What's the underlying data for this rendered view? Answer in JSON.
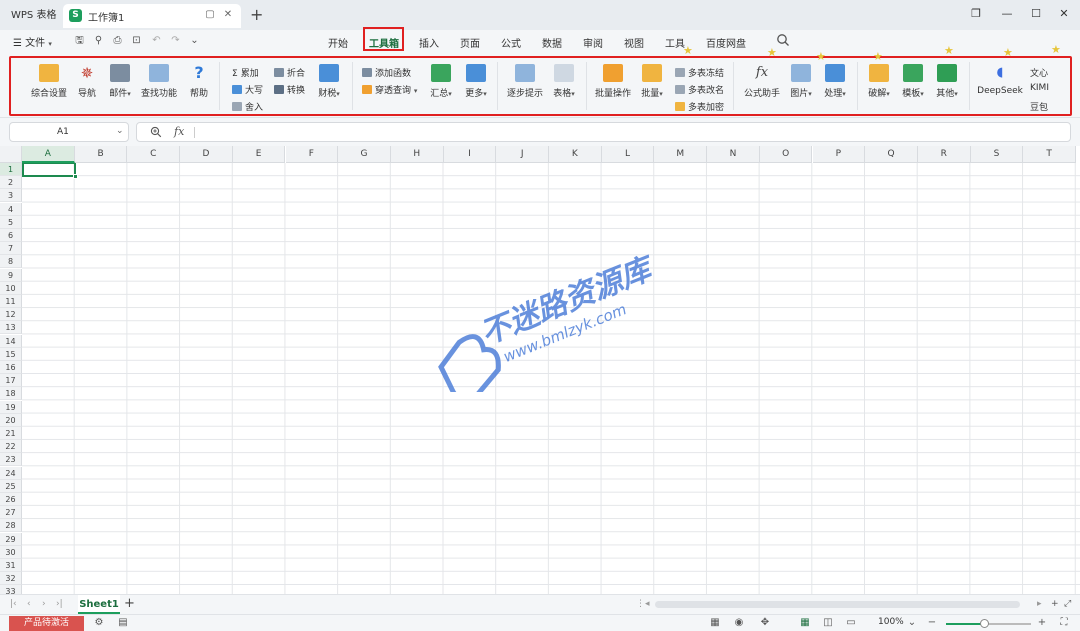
{
  "titlebar": {
    "app_tab": "WPS 表格",
    "doc_logo": "S",
    "doc_title": "工作簿1",
    "new_tab": "+"
  },
  "menubar": {
    "file": "文件",
    "tabs": [
      "开始",
      "工具箱",
      "插入",
      "页面",
      "公式",
      "数据",
      "审阅",
      "视图",
      "工具",
      "百度网盘"
    ],
    "active_tab": "工具箱"
  },
  "ribbon": {
    "big_buttons": [
      "综合设置",
      "导航",
      "邮件",
      "查找功能",
      "帮助",
      "财税",
      "汇总",
      "更多",
      "逐步提示",
      "表格",
      "批量操作",
      "批量",
      "公式助手",
      "图片",
      "处理",
      "破解",
      "模板",
      "其他",
      "DeepSeek"
    ],
    "small_buttons": [
      "累加",
      "折合",
      "大写",
      "转换",
      "舍入",
      "添加函数",
      "穿透查询",
      "多表冻结",
      "多表改名",
      "多表加密",
      "文心",
      "KIMI",
      "豆包"
    ],
    "colors": {
      "icon_blue": "#4a8fd8",
      "icon_orange": "#f0a030",
      "icon_green": "#3aa55d",
      "icon_red": "#e05040",
      "highlight": "#e02020"
    }
  },
  "formula_bar": {
    "cell_ref": "A1",
    "fx": "fx",
    "value": ""
  },
  "sheet": {
    "columns": [
      "A",
      "B",
      "C",
      "D",
      "E",
      "F",
      "G",
      "H",
      "I",
      "J",
      "K",
      "L",
      "M",
      "N",
      "O",
      "P",
      "Q",
      "R",
      "S",
      "T"
    ],
    "rows": [
      "1",
      "2",
      "3",
      "4",
      "5",
      "6",
      "7",
      "8",
      "9",
      "10",
      "11",
      "12",
      "13",
      "14",
      "15",
      "16",
      "17",
      "18",
      "19",
      "20",
      "21",
      "22",
      "23",
      "24",
      "25",
      "26",
      "27",
      "28",
      "29",
      "30",
      "31",
      "32",
      "33"
    ],
    "selected_cell": "A1"
  },
  "watermark": {
    "title": "不迷路资源库",
    "url": "www.bmlzyk.com"
  },
  "sheet_tabs": {
    "tabs": [
      "Sheet1"
    ],
    "add": "+"
  },
  "statusbar": {
    "activate_label": "产品待激活",
    "zoom": "100%",
    "zoom_fraction": 0.45,
    "minus": "−",
    "plus": "+"
  }
}
